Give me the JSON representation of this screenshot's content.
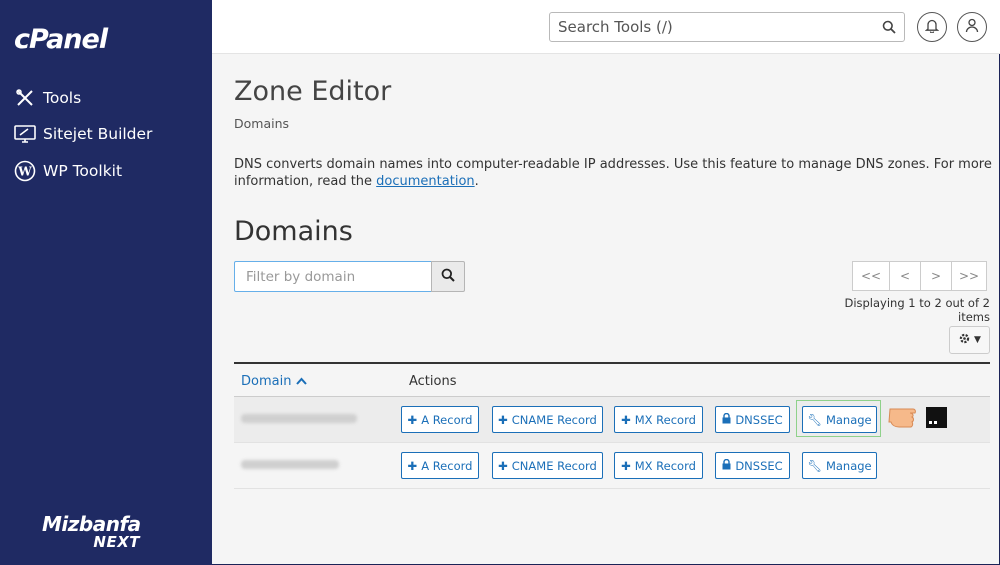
{
  "sidebar": {
    "logo": "cPanel",
    "items": [
      {
        "label": "Tools",
        "icon": "tools-icon"
      },
      {
        "label": "Sitejet Builder",
        "icon": "sitejet-monitor-icon"
      },
      {
        "label": "WP Toolkit",
        "icon": "wordpress-icon"
      }
    ],
    "brand_line1": "Mizbanfa",
    "brand_line2": "NEXT"
  },
  "topbar": {
    "search_placeholder": "Search Tools (/)"
  },
  "page": {
    "title": "Zone Editor",
    "breadcrumb": "Domains",
    "description_text": "DNS converts domain names into computer-readable IP addresses. Use this feature to manage DNS zones. For more information, read the ",
    "description_link": "documentation",
    "description_end": ".",
    "section_title": "Domains",
    "filter_placeholder": "Filter by domain",
    "pager": {
      "first": "<<",
      "prev": "<",
      "next": ">",
      "last": ">>"
    },
    "displaying": "Displaying 1 to 2 out of 2 items"
  },
  "table": {
    "col_domain": "Domain",
    "col_actions": "Actions",
    "actions": {
      "a_record": "A Record",
      "cname_record": "CNAME Record",
      "mx_record": "MX Record",
      "dnssec": "DNSSEC",
      "manage": "Manage"
    }
  },
  "colors": {
    "sidebar_bg": "#1f2a63",
    "link_blue": "#1b6fb8",
    "highlight_green": "#8fd18a"
  }
}
